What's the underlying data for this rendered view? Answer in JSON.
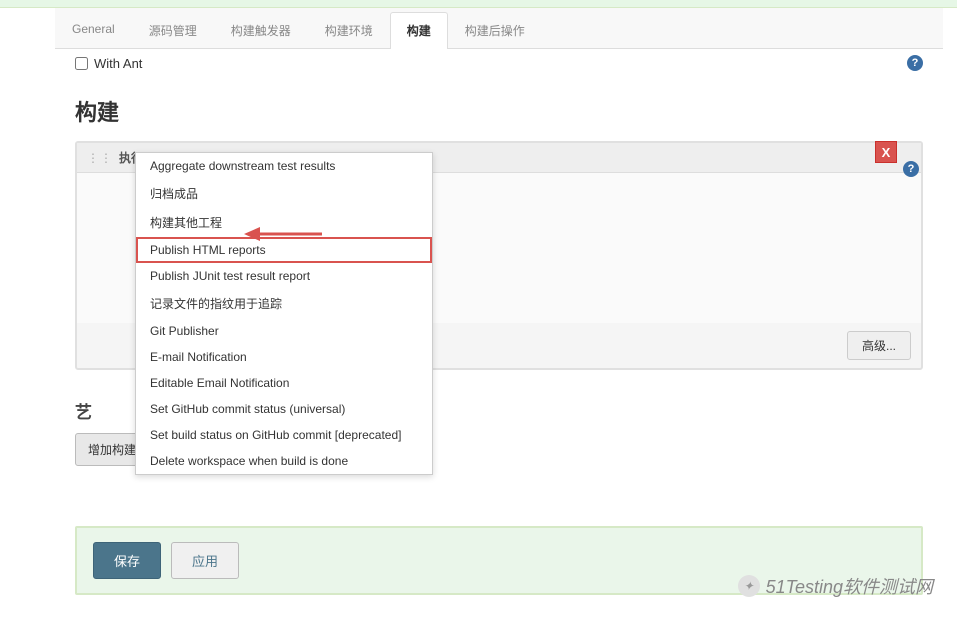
{
  "tabs": {
    "general": "General",
    "source": "源码管理",
    "triggers": "构建触发器",
    "env": "构建环境",
    "build": "构建",
    "post": "构建后操作"
  },
  "withAnt": {
    "label": "With Ant"
  },
  "section": {
    "build_title": "构建"
  },
  "buildStep": {
    "label": "执行 shell"
  },
  "closeBtn": {
    "label": "X"
  },
  "advanced": {
    "label": "高级..."
  },
  "post_partial_title": "艺",
  "addPostStep": {
    "label": "增加构建后操作步骤"
  },
  "actions": {
    "save": "保存",
    "apply": "应用"
  },
  "dropdown": {
    "items": [
      "Aggregate downstream test results",
      "归档成品",
      "构建其他工程",
      "Publish HTML reports",
      "Publish JUnit test result report",
      "记录文件的指纹用于追踪",
      "Git Publisher",
      "E-mail Notification",
      "Editable Email Notification",
      "Set GitHub commit status (universal)",
      "Set build status on GitHub commit [deprecated]",
      "Delete workspace when build is done"
    ],
    "highlighted_index": 3
  },
  "watermark": {
    "text": "51Testing软件测试网"
  }
}
